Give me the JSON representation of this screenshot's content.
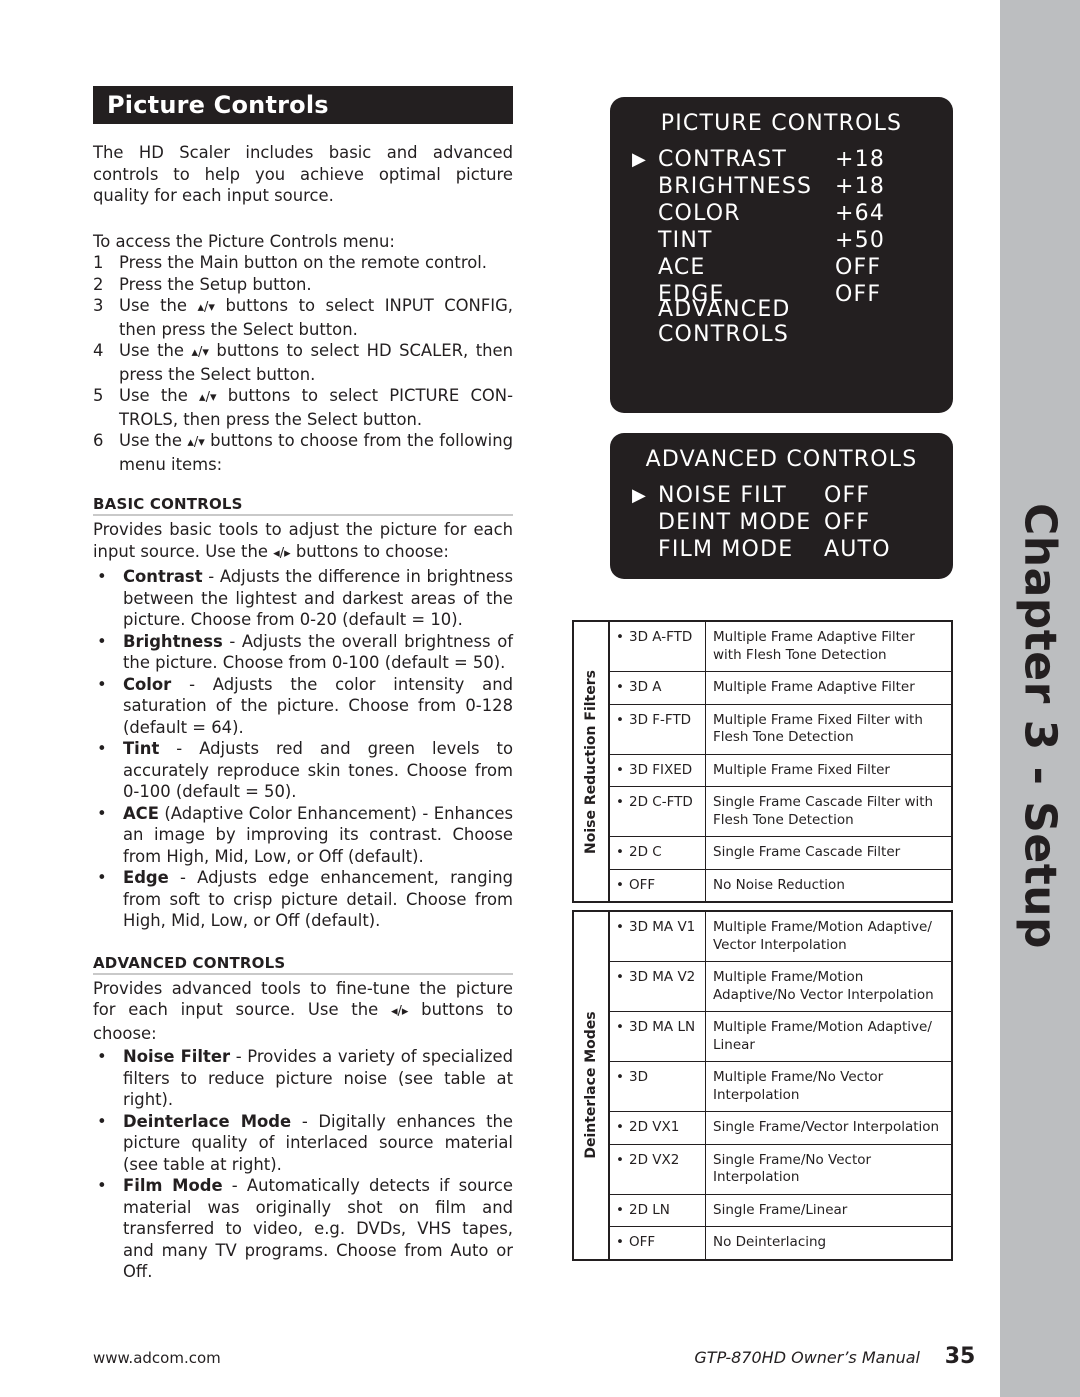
{
  "page": {
    "title": "Picture Controls",
    "chapter_tab": "Chapter 3 - Setup"
  },
  "intro": {
    "paragraph": "The HD Scaler includes basic and advanced controls to help you achieve optimal picture quality for each input source.",
    "access_lead": "To access the Picture Controls menu:"
  },
  "steps": [
    {
      "num": "1",
      "text": "Press the Main button on the remote control."
    },
    {
      "num": "2",
      "text": "Press the Setup button."
    },
    {
      "num": "3",
      "text_before": "Use the ",
      "arrows": "▴/▾",
      "text_after": " buttons to select INPUT CONFIG, then press the Select button."
    },
    {
      "num": "4",
      "text_before": "Use the ",
      "arrows": "▴/▾",
      "text_after": " buttons to select HD SCALER, then press the Select button."
    },
    {
      "num": "5",
      "text_before": "Use the ",
      "arrows": "▴/▾",
      "text_after": " buttons to select PICTURE CON-TROLS, then press the Select button."
    },
    {
      "num": "6",
      "text_before": "Use the ",
      "arrows": "▴/▾",
      "text_after": " buttons to choose from the following menu items:"
    }
  ],
  "basic_controls": {
    "heading": "BASIC CONTROLS",
    "intro_before": "Provides basic tools to adjust the picture for each input source. Use the ",
    "intro_arrows": "◂/▸",
    "intro_after": " buttons to choose:",
    "items": [
      {
        "term": "Contrast",
        "desc": " - Adjusts the difference in brightness between the lightest and darkest areas of the picture. Choose from 0-20 (default = 10)."
      },
      {
        "term": "Brightness",
        "desc": " - Adjusts the overall brightness of the picture. Choose from 0-100 (default = 50)."
      },
      {
        "term": "Color",
        "desc": " - Adjusts the color intensity and saturation of the picture. Choose from 0-128 (default = 64)."
      },
      {
        "term": "Tint",
        "desc": " - Adjusts red and green levels to accurately reproduce skin tones. Choose from 0-100 (default = 50)."
      },
      {
        "term": "ACE",
        "desc": " (Adaptive Color Enhancement) - Enhances an image by improving its contrast. Choose from High, Mid, Low, or Off (default)."
      },
      {
        "term": "Edge",
        "desc": " - Adjusts edge enhancement, ranging from soft to crisp picture detail. Choose from High, Mid, Low, or Off (default)."
      }
    ]
  },
  "advanced_controls": {
    "heading": "ADVANCED CONTROLS",
    "intro_before": "Provides advanced tools to fine-tune the picture for each input source. Use the ",
    "intro_arrows": "◂/▸",
    "intro_after": " buttons to choose:",
    "items": [
      {
        "term": "Noise Filter",
        "desc": " - Provides a variety of specialized filters to reduce picture noise (see table at right)."
      },
      {
        "term": "Deinterlace Mode",
        "desc": " - Digitally enhances the picture quality of interlaced source material (see table at right)."
      },
      {
        "term": "Film Mode",
        "desc": " - Automatically detects if source material was originally shot on film and transferred to video, e.g. DVDs, VHS tapes, and many TV programs. Choose from Auto or Off."
      }
    ]
  },
  "osd_picture": {
    "title": "PICTURE CONTROLS",
    "rows": [
      {
        "selected": true,
        "name": "CONTRAST",
        "value": "+18"
      },
      {
        "selected": false,
        "name": "BRIGHTNESS",
        "value": "+18"
      },
      {
        "selected": false,
        "name": "COLOR",
        "value": "+64"
      },
      {
        "selected": false,
        "name": "TINT",
        "value": "+50"
      },
      {
        "selected": false,
        "name": "ACE",
        "value": "OFF"
      },
      {
        "selected": false,
        "name": "EDGE",
        "value": "OFF"
      },
      {
        "selected": false,
        "name": "ADVANCED CONTROLS",
        "value": ""
      }
    ]
  },
  "osd_advanced": {
    "title": "ADVANCED CONTROLS",
    "rows": [
      {
        "selected": true,
        "name": "NOISE FILT",
        "value": "OFF"
      },
      {
        "selected": false,
        "name": "DEINT MODE",
        "value": "OFF"
      },
      {
        "selected": false,
        "name": "FILM MODE",
        "value": "AUTO"
      }
    ]
  },
  "table_noise": {
    "label": "Noise Reduction Filters",
    "rows": [
      {
        "key": "3D A-FTD",
        "desc": "Multiple Frame Adaptive Filter with Flesh Tone Detection"
      },
      {
        "key": "3D A",
        "desc": "Multiple Frame Adaptive Filter"
      },
      {
        "key": "3D F-FTD",
        "desc": "Multiple Frame Fixed Filter with Flesh Tone Detection"
      },
      {
        "key": "3D FIXED",
        "desc": "Multiple Frame Fixed Filter"
      },
      {
        "key": "2D C-FTD",
        "desc": "Single Frame Cascade Filter with Flesh Tone Detection"
      },
      {
        "key": "2D C",
        "desc": "Single Frame Cascade Filter"
      },
      {
        "key": "OFF",
        "desc": "No Noise Reduction"
      }
    ]
  },
  "table_deint": {
    "label": "Deinterlace Modes",
    "rows": [
      {
        "key": "3D MA V1",
        "desc": "Multiple Frame/Motion Adaptive/ Vector Interpolation"
      },
      {
        "key": "3D MA V2",
        "desc": "Multiple Frame/Motion Adaptive/No Vector Interpolation"
      },
      {
        "key": "3D MA LN",
        "desc": "Multiple Frame/Motion Adaptive/ Linear"
      },
      {
        "key": "3D",
        "desc": "Multiple Frame/No Vector Interpolation"
      },
      {
        "key": "2D VX1",
        "desc": "Single Frame/Vector Interpolation"
      },
      {
        "key": "2D VX2",
        "desc": "Single Frame/No Vector Interpolation"
      },
      {
        "key": "2D LN",
        "desc": "Single Frame/Linear"
      },
      {
        "key": "OFF",
        "desc": "No Deinterlacing"
      }
    ]
  },
  "footer": {
    "website": "www.adcom.com",
    "manual": "GTP-870HD Owner’s Manual",
    "page_number": "35"
  },
  "colors": {
    "ink": "#231f20",
    "tab_gray": "#bcbec0",
    "rule_gray": "#c9c9c9"
  }
}
